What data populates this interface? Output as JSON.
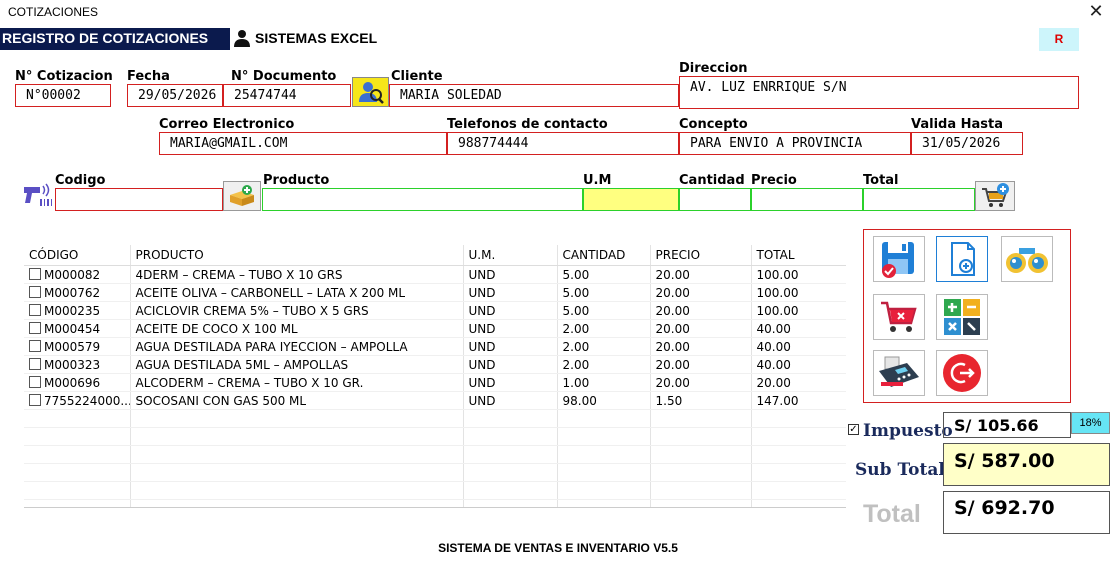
{
  "window": {
    "title": "COTIZACIONES",
    "close_glyph": "✕"
  },
  "header": {
    "title": "REGISTRO DE COTIZACIONES",
    "brand": "SISTEMAS EXCEL",
    "r_label": "R"
  },
  "form": {
    "cotizacion_label": "N° Cotizacion",
    "cotizacion_value": "N°00002",
    "fecha_label": "Fecha",
    "fecha_value": "29/05/2026",
    "documento_label": "N° Documento",
    "documento_value": "25474744",
    "cliente_label": "Cliente",
    "cliente_value": "MARIA SOLEDAD",
    "direccion_label": "Direccion",
    "direccion_value": "AV. LUZ ENRRIQUE S/N",
    "correo_label": "Correo Electronico",
    "correo_value": "MARIA@GMAIL.COM",
    "telefono_label": "Telefonos de contacto",
    "telefono_value": "988774444",
    "concepto_label": "Concepto",
    "concepto_value": "PARA ENVIO A PROVINCIA",
    "valida_label": "Valida Hasta",
    "valida_value": "31/05/2026"
  },
  "entry": {
    "codigo_label": "Codigo",
    "producto_label": "Producto",
    "um_label": "U.M",
    "cantidad_label": "Cantidad",
    "precio_label": "Precio",
    "total_label": "Total"
  },
  "table": {
    "headers": [
      "CÓDIGO",
      "PRODUCTO",
      "U.M.",
      "CANTIDAD",
      "PRECIO",
      "TOTAL"
    ],
    "rows": [
      [
        "M000082",
        "4DERM – CREMA – TUBO X 10 GRS",
        "UND",
        "5.00",
        "20.00",
        "100.00"
      ],
      [
        "M000762",
        "ACEITE OLIVA – CARBONELL – LATA X 200 ML",
        "UND",
        "5.00",
        "20.00",
        "100.00"
      ],
      [
        "M000235",
        "ACICLOVIR CREMA 5% – TUBO X 5 GRS",
        "UND",
        "5.00",
        "20.00",
        "100.00"
      ],
      [
        "M000454",
        "ACEITE DE COCO X 100 ML",
        "UND",
        "2.00",
        "20.00",
        "40.00"
      ],
      [
        "M000579",
        "AGUA DESTILADA PARA IYECCION – AMPOLLA",
        "UND",
        "2.00",
        "20.00",
        "40.00"
      ],
      [
        "M000323",
        "AGUA DESTILADA 5ML – AMPOLLAS",
        "UND",
        "2.00",
        "20.00",
        "40.00"
      ],
      [
        "M000696",
        "ALCODERM – CREMA – TUBO X 10 GR.",
        "UND",
        "1.00",
        "20.00",
        "20.00"
      ],
      [
        "7755224000...",
        "SOCOSANI CON GAS 500 ML",
        "UND",
        "98.00",
        "1.50",
        "147.00"
      ]
    ]
  },
  "totals": {
    "impuesto_label": "Impuesto",
    "impuesto_value": "S/ 105.66",
    "impuesto_rate": "18%",
    "subtotal_label": "Sub Total",
    "subtotal_value": "S/ 587.00",
    "total_label": "Total",
    "total_value": "S/ 692.70"
  },
  "footer": {
    "text": "SISTEMA DE VENTAS E INVENTARIO V5.5"
  },
  "colors": {
    "header_band": "#0b1a4d",
    "field_border": "#d32020",
    "entry_border": "#2bd12b",
    "um_fill": "#ffff80",
    "subtotal_fill": "#ffffc8",
    "rate_fill": "#66e5f5"
  }
}
